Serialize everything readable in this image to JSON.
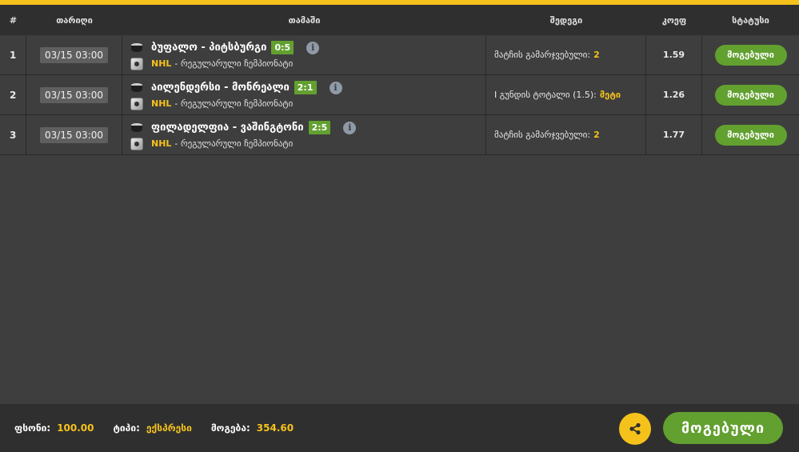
{
  "header": {
    "num": "#",
    "date": "თარიღი",
    "game": "თამაში",
    "outcome": "შედეგი",
    "coef": "კოეფ",
    "status": "სტატუსი"
  },
  "rows": [
    {
      "num": "1",
      "date": "03/15 03:00",
      "teams": "ბუფალო - პიტსბურგი",
      "score": "0:5",
      "league": "NHL",
      "championship": "- რეგულარული ჩემპიონატი",
      "outcome_label": "მატჩის გამარჯვებული:",
      "outcome_value": "2",
      "coef": "1.59",
      "status": "მოგებული"
    },
    {
      "num": "2",
      "date": "03/15 03:00",
      "teams": "აილენდერსი - მონრეალი",
      "score": "2:1",
      "league": "NHL",
      "championship": "- რეგულარული ჩემპიონატი",
      "outcome_label": "I გუნდის ტოტალი (1.5):",
      "outcome_value": "მეტი",
      "coef": "1.26",
      "status": "მოგებული"
    },
    {
      "num": "3",
      "date": "03/15 03:00",
      "teams": "ფილადელფია - ვაშინგტონი",
      "score": "2:5",
      "league": "NHL",
      "championship": "- რეგულარული ჩემპიონატი",
      "outcome_label": "მატჩის გამარჯვებული:",
      "outcome_value": "2",
      "coef": "1.77",
      "status": "მოგებული"
    }
  ],
  "footer": {
    "stake_label": "ფსონი:",
    "stake_value": "100.00",
    "type_label": "ტიპი:",
    "type_value": "ექსპრესი",
    "win_label": "მოგება:",
    "win_value": "354.60",
    "status": "მოგებული"
  },
  "icons": {
    "share": "share-icon",
    "info": "info-icon",
    "puck": "hockey-puck-icon",
    "league_logo": "nhl-logo-icon"
  },
  "colors": {
    "accent": "#f5c21b",
    "win": "#62a030",
    "background": "#3e3e3e",
    "header": "#2f2f2f"
  }
}
